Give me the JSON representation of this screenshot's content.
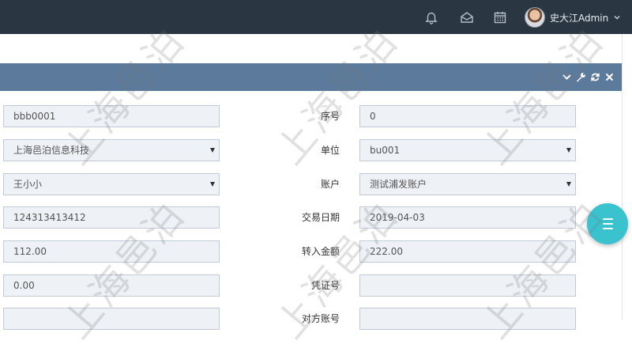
{
  "topbar": {
    "icons": [
      "bell-icon",
      "envelope-icon",
      "calendar-icon"
    ],
    "user_name": "史大江Admin",
    "background": "#2b3643"
  },
  "portlet": {
    "header_color": "#5c7a9b",
    "tools": [
      "collapse-icon",
      "config-icon",
      "reload-icon",
      "remove-icon"
    ]
  },
  "form": {
    "left_fields": [
      {
        "value": "bbb0001",
        "type": "text"
      },
      {
        "value": "上海邑泊信息科技",
        "type": "select"
      },
      {
        "value": "王小小",
        "type": "select"
      },
      {
        "value": "124313413412",
        "type": "text"
      },
      {
        "value": "112.00",
        "type": "text"
      },
      {
        "value": "0.00",
        "type": "text"
      },
      {
        "value": "",
        "type": "text"
      }
    ],
    "right_fields": [
      {
        "label": "序号",
        "value": "0",
        "type": "text"
      },
      {
        "label": "单位",
        "value": "bu001",
        "type": "select"
      },
      {
        "label": "账户",
        "value": "测试浦发账户",
        "type": "select"
      },
      {
        "label": "交易日期",
        "value": "2019-04-03",
        "type": "text"
      },
      {
        "label": "转入金额",
        "value": "222.00",
        "type": "text"
      },
      {
        "label": "凭证号",
        "value": "",
        "type": "text"
      },
      {
        "label": "对方账号",
        "value": "",
        "type": "text"
      }
    ]
  },
  "fab_color": "#3ac3cf",
  "watermark": "上海邑泊"
}
